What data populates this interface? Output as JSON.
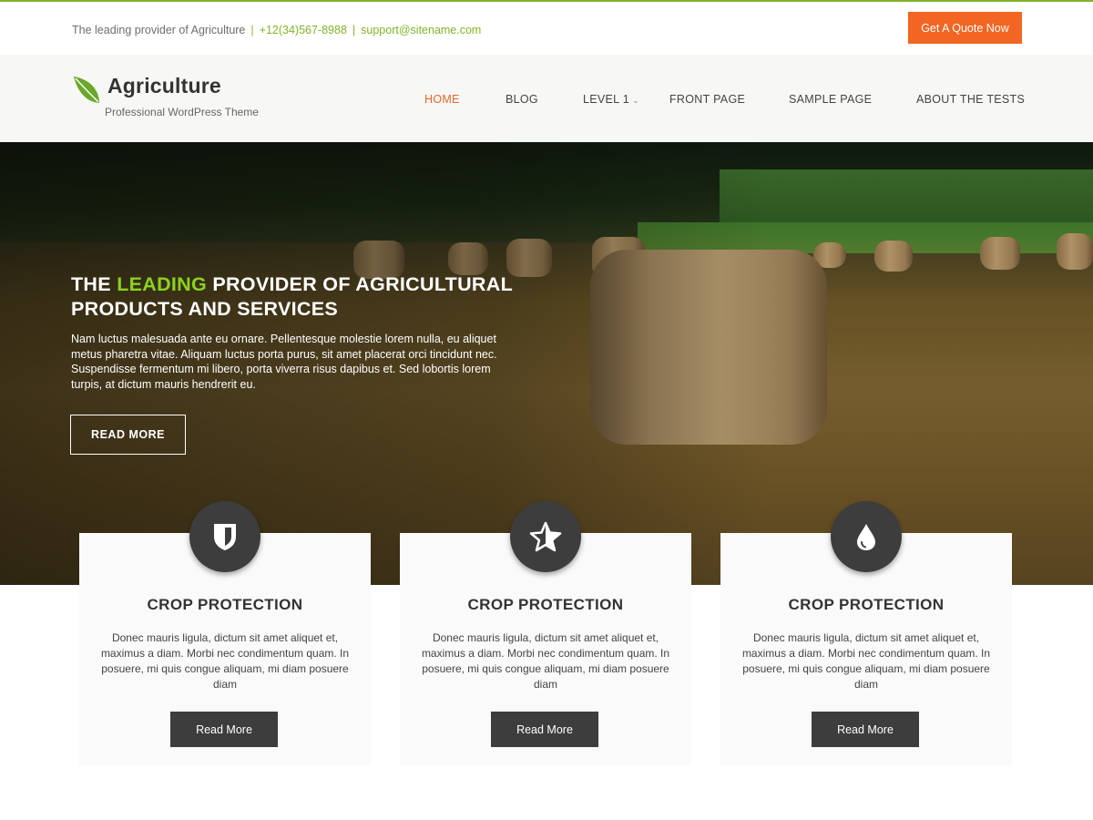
{
  "topbar": {
    "tagline": "The leading provider of Agriculture",
    "phone": "+12(34)567-8988",
    "email": "support@sitename.com",
    "quote_button": "Get A Quote Now"
  },
  "header": {
    "logo_icon": "leaf-icon",
    "site_title": "Agriculture",
    "site_tagline": "Professional WordPress Theme"
  },
  "nav": {
    "items": [
      {
        "label": "HOME",
        "active": true
      },
      {
        "label": "BLOG",
        "active": false
      },
      {
        "label": "LEVEL 1",
        "active": false,
        "has_dropdown": true
      },
      {
        "label": "FRONT PAGE",
        "active": false
      },
      {
        "label": "SAMPLE PAGE",
        "active": false
      },
      {
        "label": "ABOUT THE TESTS",
        "active": false
      }
    ],
    "dropdown_icon": "chevron-down-icon"
  },
  "hero": {
    "title_before": "THE",
    "title_highlight": "LEADING",
    "title_after": "PROVIDER OF AGRICULTURAL PRODUCTS AND SERVICES",
    "text": "Nam luctus malesuada ante eu ornare. Pellentesque molestie lorem nulla, eu aliquet metus pharetra vitae. Aliquam luctus porta purus, sit amet placerat orci tincidunt nec. Suspendisse fermentum mi libero, porta viverra risus dapibus et. Sed lobortis lorem turpis, at dictum mauris hendrerit eu.",
    "button": "READ MORE"
  },
  "cards": [
    {
      "icon": "shield-icon",
      "title": "CROP PROTECTION",
      "text": "Donec mauris ligula, dictum sit amet aliquet et, maximus a diam. Morbi nec condimentum quam. In posuere, mi quis congue aliquam, mi diam posuere diam",
      "button": "Read More"
    },
    {
      "icon": "star-icon",
      "title": "CROP PROTECTION",
      "text": "Donec mauris ligula, dictum sit amet aliquet et, maximus a diam. Morbi nec condimentum quam. In posuere, mi quis congue aliquam, mi diam posuere diam",
      "button": "Read More"
    },
    {
      "icon": "water-drop-icon",
      "title": "CROP PROTECTION",
      "text": "Donec mauris ligula, dictum sit amet aliquet et, maximus a diam. Morbi nec condimentum quam. In posuere, mi quis congue aliquam, mi diam posuere diam",
      "button": "Read More"
    }
  ],
  "colors": {
    "accent_green": "#7fb428",
    "highlight_green": "#8bd21e",
    "quote_orange": "#f26522",
    "nav_active": "#e8652a",
    "dark": "#3d3d3d"
  }
}
